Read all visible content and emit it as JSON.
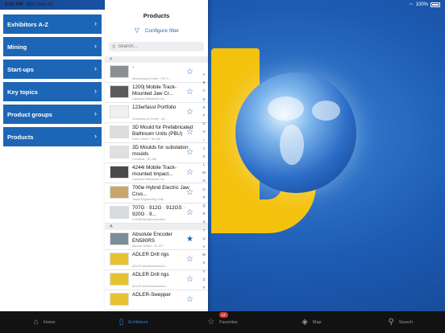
{
  "status_bar": {
    "time": "2:43 PM",
    "date": "Mon Sep 19",
    "battery": "100%"
  },
  "left_menu": [
    {
      "label": "Exhibitors A-Z"
    },
    {
      "label": "Mining"
    },
    {
      "label": "Start-ups"
    },
    {
      "label": "Key topics"
    },
    {
      "label": "Product groups"
    },
    {
      "label": "Products"
    }
  ],
  "panel": {
    "title": "Products",
    "filter_label": "Configure filter",
    "search_placeholder": "Search..."
  },
  "sections": [
    {
      "letter": "#",
      "rows": [
        {
          "name": "-",
          "sub": "Bindemixand GmbH · FW G...",
          "starred": false
        },
        {
          "name": "1200j Mobile Track-Mounted Jaw Cr...",
          "sub": "Lippmann Milwaukee Inc...",
          "starred": false
        },
        {
          "name": "123erfasst Portfolio",
          "sub": "123erfasst.de GmbH · A2...",
          "starred": false
        },
        {
          "name": "3D Mould for Prefabricated Bathroom Units (PBU)",
          "sub": "Potec GmbH · B1.346",
          "starred": false
        },
        {
          "name": "3D Moulds for substation moulds",
          "sub": "Combinar · B1.346",
          "starred": false
        },
        {
          "name": "4244i Mobile Track-mounted Impact...",
          "sub": "Lippmann Milwaukee Inc...",
          "starred": false
        },
        {
          "name": "700ie Hybrid Electric Jaw Crus...",
          "sub": "Tesab Engineering Limit...",
          "starred": false
        },
        {
          "name": "707G · 912G · 912GS · 920G · 9...",
          "sub": "HYDREMA Baumaschine...",
          "starred": false
        }
      ]
    },
    {
      "letter": "A",
      "rows": [
        {
          "name": "Absolute Encoder EN580RS",
          "sub": "Baumer GmbH · A2.107",
          "starred": true
        },
        {
          "name": "ADLER Drill rigs",
          "sub": "ADLER Arbeitsmaschinen...",
          "starred": false
        },
        {
          "name": "ADLER Drill rigs",
          "sub": "ADLER Arbeitsmaschinen...",
          "starred": false
        },
        {
          "name": "ADLER-Swepper",
          "sub": "",
          "starred": false
        }
      ]
    }
  ],
  "alphabet": [
    "A",
    "B",
    "C",
    "D",
    "E",
    "F",
    "G",
    "H",
    "I",
    "J",
    "K",
    "L",
    "M",
    "N",
    "O",
    "P",
    "Q",
    "R",
    "S",
    "T",
    "U",
    "V",
    "W",
    "X",
    "Y",
    "Z",
    "#"
  ],
  "tabbar": [
    {
      "label": "Home",
      "icon": "home-icon",
      "glyph": "⌂",
      "active": false
    },
    {
      "label": "Exhibitors",
      "icon": "phone-icon",
      "glyph": "▯",
      "active": true
    },
    {
      "label": "Favorites",
      "icon": "star-icon",
      "glyph": "☆",
      "active": false,
      "badge": "14"
    },
    {
      "label": "Map",
      "icon": "map-icon",
      "glyph": "◈",
      "active": false
    },
    {
      "label": "Search",
      "icon": "search-icon",
      "glyph": "⚲",
      "active": false
    }
  ],
  "colors": {
    "accent": "#1c66b5",
    "brand_yellow": "#f4c20d",
    "tab_active": "#2e80e0",
    "badge": "#d93b2b"
  }
}
